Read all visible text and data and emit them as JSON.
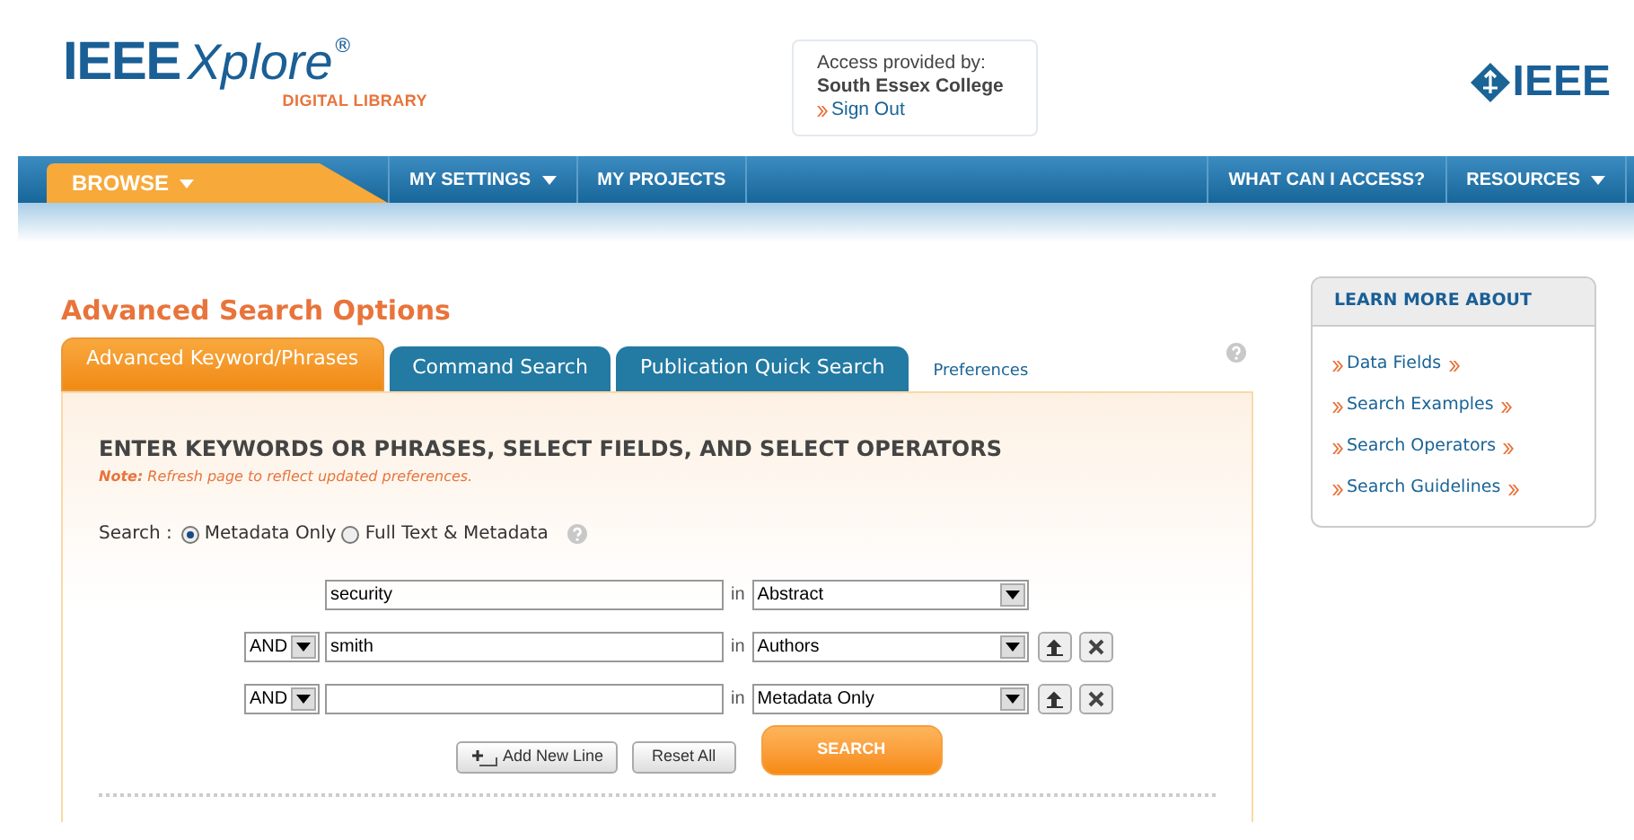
{
  "header": {
    "logo": {
      "word1": "IEEE",
      "word2": "Xplore",
      "mark": "®",
      "subtitle": "DIGITAL LIBRARY"
    },
    "access": {
      "label": "Access provided by:",
      "institution": "South Essex College",
      "sign_out": "Sign Out"
    },
    "brand": "IEEE"
  },
  "nav": {
    "left": [
      {
        "label": "BROWSE",
        "dropdown": true,
        "selected": true
      },
      {
        "label": "MY SETTINGS",
        "dropdown": true,
        "selected": false
      },
      {
        "label": "MY PROJECTS",
        "dropdown": false,
        "selected": false
      }
    ],
    "right": [
      {
        "label": "WHAT CAN I ACCESS?",
        "dropdown": false,
        "selected": false
      },
      {
        "label": "RESOURCES",
        "dropdown": true,
        "selected": false
      }
    ]
  },
  "title": "Advanced Search Options",
  "tabs": [
    {
      "label": "Advanced Keyword/Phrases",
      "selected": true
    },
    {
      "label": "Command Search",
      "selected": false
    },
    {
      "label": "Publication Quick Search",
      "selected": false
    }
  ],
  "preferences_link": "Preferences",
  "panel": {
    "heading": "ENTER KEYWORDS OR PHRASES, SELECT FIELDS, AND SELECT OPERATORS",
    "note_label": "Note:",
    "note": "Refresh page to reflect updated preferences.",
    "search_label": "Search :",
    "scope_options": [
      {
        "label": "Metadata Only",
        "selected": true
      },
      {
        "label": "Full Text & Metadata",
        "selected": false
      }
    ],
    "rows": [
      {
        "term": "security",
        "in": "in",
        "field": "Abstract"
      },
      {
        "operator": "AND",
        "term": "smith",
        "in": "in",
        "field": "Authors"
      },
      {
        "operator": "AND",
        "term": "",
        "in": "in",
        "field": "Metadata Only"
      }
    ],
    "buttons": {
      "add": "Add New Line",
      "reset": "Reset All",
      "search": "SEARCH"
    }
  },
  "sidebar": {
    "title": "LEARN MORE ABOUT",
    "links": [
      "Data Fields",
      "Search Examples",
      "Search Operators",
      "Search Guidelines"
    ]
  }
}
